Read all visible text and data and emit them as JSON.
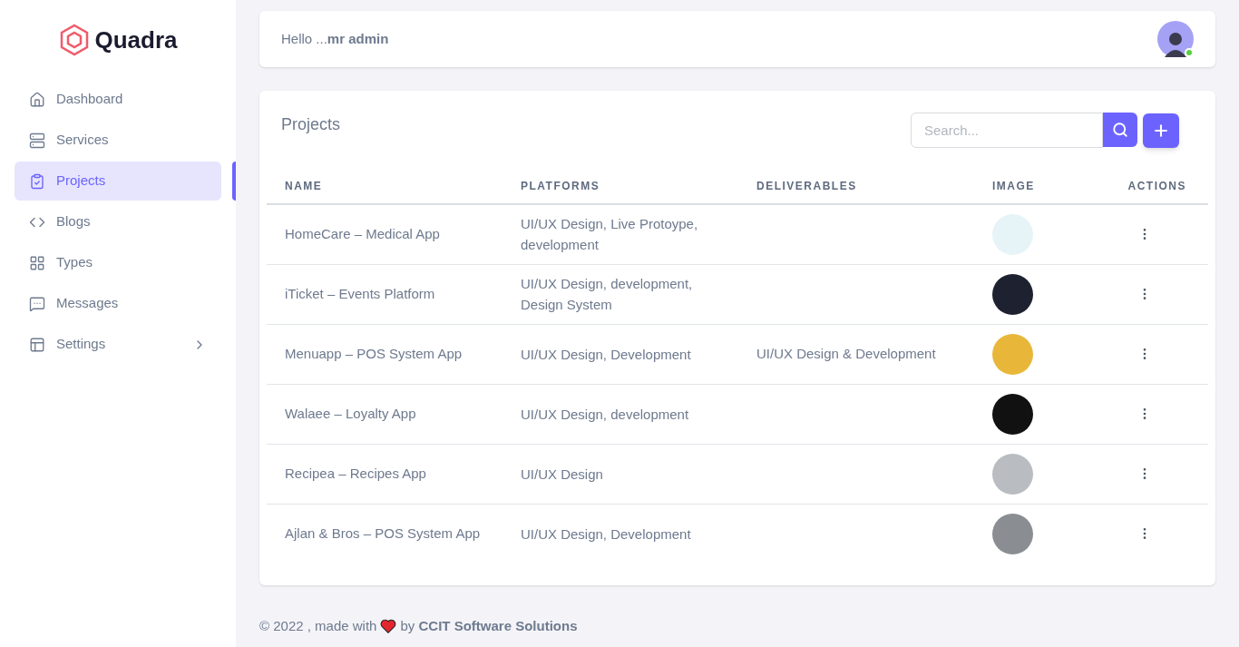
{
  "sidebar": {
    "logo": "Quadra",
    "items": [
      {
        "label": "Dashboard",
        "selected": false,
        "expandable": false
      },
      {
        "label": "Services",
        "selected": false,
        "expandable": false
      },
      {
        "label": "Projects",
        "selected": true,
        "expandable": false
      },
      {
        "label": "Blogs",
        "selected": false,
        "expandable": false
      },
      {
        "label": "Types",
        "selected": false,
        "expandable": false
      },
      {
        "label": "Messages",
        "selected": false,
        "expandable": false
      },
      {
        "label": "Settings",
        "selected": false,
        "expandable": true
      }
    ]
  },
  "header": {
    "greeting": "Hello ...**mr admin**",
    "online": true
  },
  "projects": {
    "title": "Projects",
    "search": {
      "placeholder": "Search..."
    },
    "columns": [
      "NAME",
      "PLATFORMS",
      "DELIVERABLES",
      "IMAGE",
      "ACTIONS"
    ],
    "rows": [
      {
        "name": "HomeCare – Medical App",
        "platforms": "UI/UX Design, Live Protoype, development"
      },
      {
        "name": "iTicket – Events Platform",
        "platforms": "UI/UX Design, development, Design System"
      },
      {
        "name": "Menuapp – POS System App",
        "platforms": "UI/UX Design, Development",
        "deliverables": "UI/UX Design & Development"
      },
      {
        "name": "Walaee – Loyalty App",
        "platforms": "UI/UX Design, development"
      },
      {
        "name": "Recipea – Recipes App",
        "platforms": "UI/UX Design"
      },
      {
        "name": "Ajlan & Bros – POS System App",
        "platforms": "UI/UX Design, Development"
      }
    ]
  },
  "footer": {
    "before": "© 2022 , made with",
    "after": "by **CCIT Software Solutions**"
  }
}
